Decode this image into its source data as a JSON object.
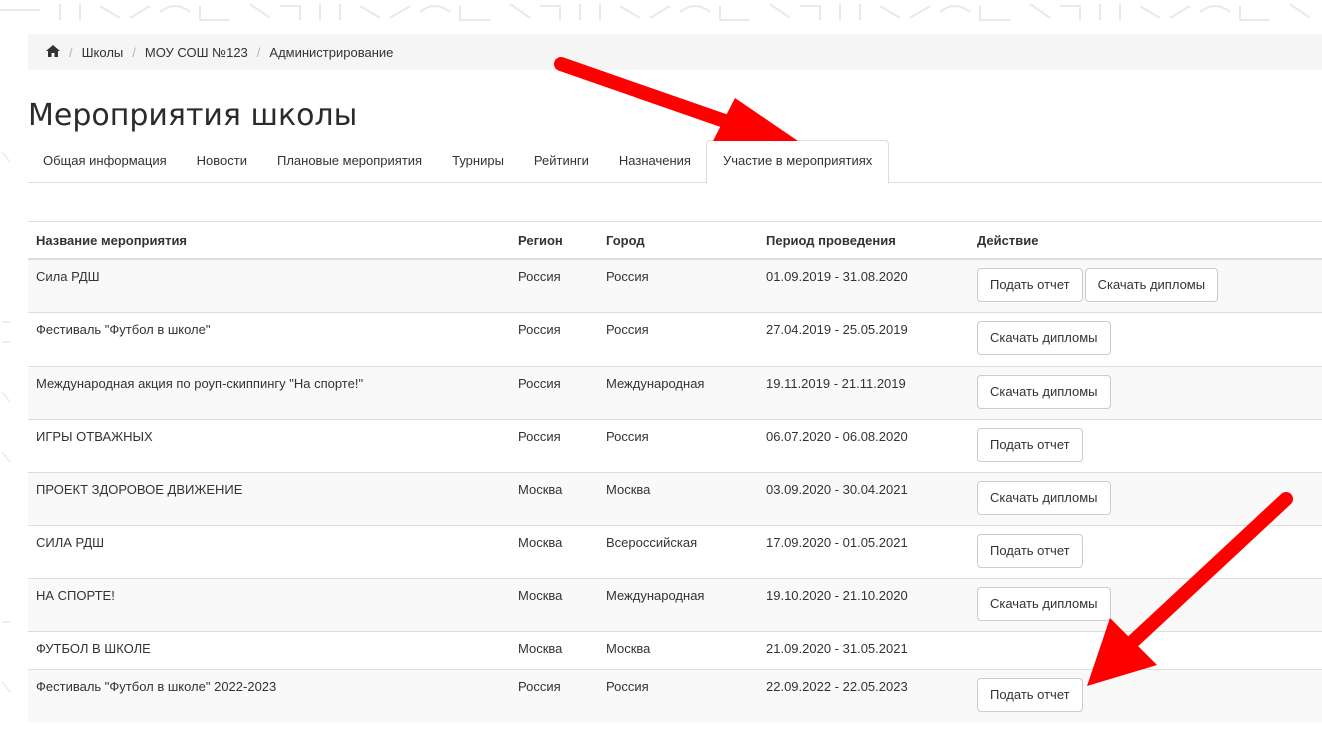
{
  "breadcrumb": {
    "home_icon": "home-icon",
    "items": [
      "Школы",
      "МОУ СОШ №123",
      "Администрирование"
    ],
    "separator": "/"
  },
  "page_title": "Мероприятия школы",
  "tabs": [
    {
      "label": "Общая информация",
      "active": false
    },
    {
      "label": "Новости",
      "active": false
    },
    {
      "label": "Плановые мероприятия",
      "active": false
    },
    {
      "label": "Турниры",
      "active": false
    },
    {
      "label": "Рейтинги",
      "active": false
    },
    {
      "label": "Назначения",
      "active": false
    },
    {
      "label": "Участие в мероприятиях",
      "active": true
    }
  ],
  "table": {
    "headers": [
      "Название мероприятия",
      "Регион",
      "Город",
      "Период проведения",
      "Действие"
    ],
    "rows": [
      {
        "name": "Сила РДШ",
        "region": "Россия",
        "city": "Россия",
        "period": "01.09.2019 - 31.08.2020",
        "actions": [
          "Подать отчет",
          "Скачать дипломы"
        ]
      },
      {
        "name": "Фестиваль \"Футбол в школе\"",
        "region": "Россия",
        "city": "Россия",
        "period": "27.04.2019 - 25.05.2019",
        "actions": [
          "Скачать дипломы"
        ]
      },
      {
        "name": "Международная акция по роуп-скиппингу \"На спорте!\"",
        "region": "Россия",
        "city": "Международная",
        "period": "19.11.2019 - 21.11.2019",
        "actions": [
          "Скачать дипломы"
        ]
      },
      {
        "name": "ИГРЫ ОТВАЖНЫХ",
        "region": "Россия",
        "city": "Россия",
        "period": "06.07.2020 - 06.08.2020",
        "actions": [
          "Подать отчет"
        ]
      },
      {
        "name": "ПРОЕКТ ЗДОРОВОЕ ДВИЖЕНИЕ",
        "region": "Москва",
        "city": "Москва",
        "period": "03.09.2020 - 30.04.2021",
        "actions": [
          "Скачать дипломы"
        ]
      },
      {
        "name": "СИЛА РДШ",
        "region": "Москва",
        "city": "Всероссийская",
        "period": "17.09.2020 - 01.05.2021",
        "actions": [
          "Подать отчет"
        ]
      },
      {
        "name": "НА СПОРТЕ!",
        "region": "Москва",
        "city": "Международная",
        "period": "19.10.2020 - 21.10.2020",
        "actions": [
          "Скачать дипломы"
        ]
      },
      {
        "name": "ФУТБОЛ В ШКОЛЕ",
        "region": "Москва",
        "city": "Москва",
        "period": "21.09.2020 - 31.05.2021",
        "actions": []
      },
      {
        "name": "Фестиваль \"Футбол в школе\" 2022-2023",
        "region": "Россия",
        "city": "Россия",
        "period": "22.09.2022 - 22.05.2023",
        "actions": [
          "Подать отчет"
        ]
      }
    ]
  },
  "colors": {
    "arrow": "#ff0000",
    "striped_row": "#f9f9f9",
    "breadcrumb_bg": "#f5f5f5",
    "border": "#dddddd"
  }
}
